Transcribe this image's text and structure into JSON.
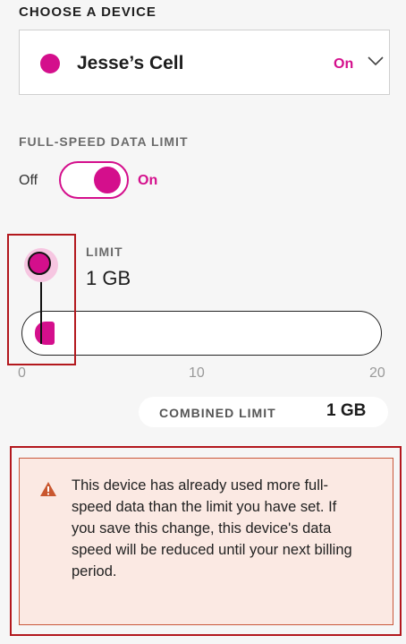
{
  "device_section": {
    "title": "CHOOSE A DEVICE",
    "selected_device": "Jesse’s Cell",
    "status": "On",
    "dot_color": "#d40f8c"
  },
  "data_limit": {
    "title": "FULL-SPEED DATA LIMIT",
    "toggle": {
      "off_label": "Off",
      "on_label": "On",
      "state": "on"
    }
  },
  "limit": {
    "label": "LIMIT",
    "value": "1 GB",
    "slider": {
      "value": 1,
      "min": 0,
      "max": 20,
      "ticks": [
        "0",
        "10",
        "20"
      ]
    }
  },
  "combined": {
    "label": "COMBINED LIMIT",
    "value": "1 GB"
  },
  "warning": {
    "icon": "warning-triangle-icon",
    "text": "This device has already used more full-speed data than the limit you have set. If you save this change, this device's data speed will be reduced until your next billing period."
  },
  "colors": {
    "accent": "#d40f8c",
    "highlight": "#b3181d",
    "warning_bg": "#fbe9e3"
  }
}
